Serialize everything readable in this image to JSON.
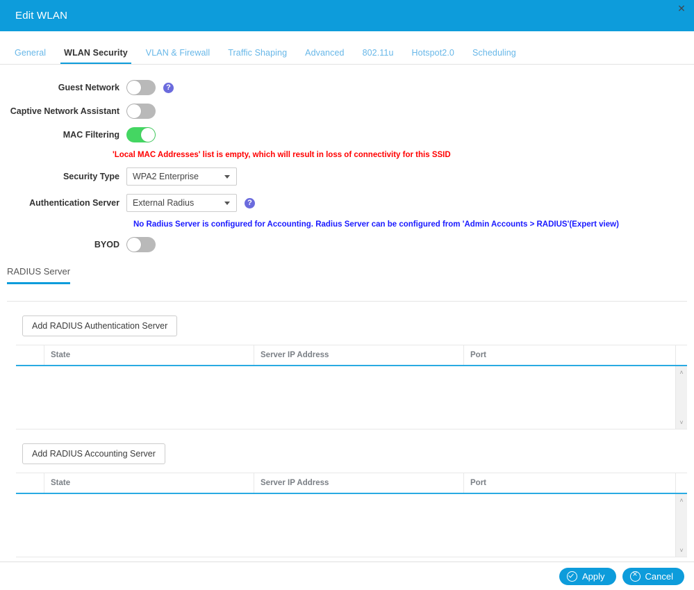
{
  "window": {
    "title": "Edit WLAN",
    "close_label": "✕"
  },
  "tabs": [
    {
      "label": "General",
      "active": false
    },
    {
      "label": "WLAN Security",
      "active": true
    },
    {
      "label": "VLAN & Firewall",
      "active": false
    },
    {
      "label": "Traffic Shaping",
      "active": false
    },
    {
      "label": "Advanced",
      "active": false
    },
    {
      "label": "802.11u",
      "active": false
    },
    {
      "label": "Hotspot2.0",
      "active": false
    },
    {
      "label": "Scheduling",
      "active": false
    }
  ],
  "form": {
    "guest_network": {
      "label": "Guest Network",
      "state": "off",
      "help": "?"
    },
    "captive_network_assistant": {
      "label": "Captive Network Assistant",
      "state": "off"
    },
    "mac_filtering": {
      "label": "MAC Filtering",
      "state": "on"
    },
    "mac_warning": "'Local MAC Addresses' list is empty, which will result in loss of connectivity for this SSID",
    "security_type": {
      "label": "Security Type",
      "value": "WPA2 Enterprise"
    },
    "authentication_server": {
      "label": "Authentication Server",
      "value": "External Radius",
      "help": "?"
    },
    "radius_notice": "No Radius Server is configured for Accounting. Radius Server can be configured from 'Admin Accounts > RADIUS'(Expert view)",
    "byod": {
      "label": "BYOD",
      "state": "off"
    }
  },
  "section": {
    "subtab_label": "RADIUS Server"
  },
  "auth_table": {
    "add_button": "Add RADIUS Authentication Server",
    "columns": [
      "",
      "State",
      "Server IP Address",
      "Port"
    ],
    "rows": []
  },
  "acct_table": {
    "add_button": "Add RADIUS Accounting Server",
    "columns": [
      "",
      "State",
      "Server IP Address",
      "Port"
    ],
    "rows": []
  },
  "footer": {
    "apply_label": "Apply",
    "cancel_label": "Cancel"
  },
  "colors": {
    "header_blue": "#0d9cdb",
    "toggle_on_green": "#44d662",
    "toggle_off_gray": "#b9b9b9",
    "help_purple": "#6b6bdd",
    "warning_red": "#ff0000",
    "notice_blue": "#1a1aff",
    "tab_link_blue": "#67b7e8"
  },
  "scroll": {
    "up": "˄",
    "down": "˅"
  }
}
